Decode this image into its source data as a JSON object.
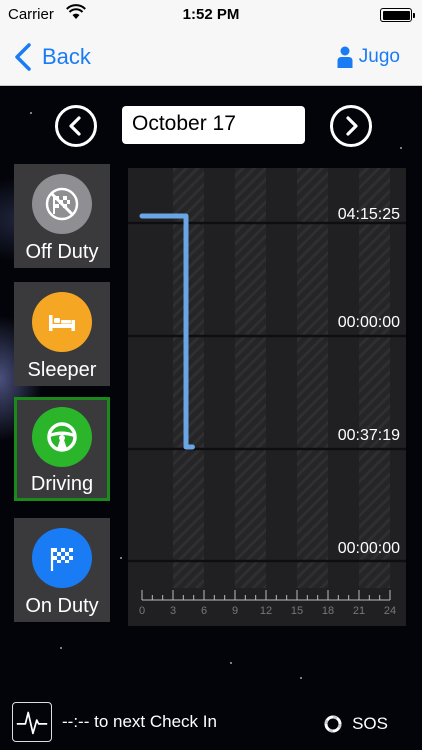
{
  "status_bar": {
    "carrier": "Carrier",
    "time": "1:52 PM"
  },
  "nav": {
    "back_label": "Back",
    "user_label": "Jugo",
    "accent": "#1a7cf5"
  },
  "date_selector": {
    "date": "October 17",
    "prev_icon": "chevron-left-circle-icon",
    "next_icon": "chevron-right-circle-icon"
  },
  "statuses": [
    {
      "key": "off-duty",
      "label": "Off Duty",
      "icon": "no-checkered-flag-icon",
      "color": "#8e8e93",
      "active": false
    },
    {
      "key": "sleeper",
      "label": "Sleeper",
      "icon": "bed-icon",
      "color": "#f5a623",
      "active": false
    },
    {
      "key": "driving",
      "label": "Driving",
      "icon": "steering-wheel-icon",
      "color": "#2bb52b",
      "active": true
    },
    {
      "key": "on-duty",
      "label": "On Duty",
      "icon": "checkered-flag-icon",
      "color": "#1a7cf5",
      "active": false
    }
  ],
  "chart_data": {
    "type": "line",
    "x_ticks": [
      "0",
      "3",
      "6",
      "9",
      "12",
      "15",
      "18",
      "21",
      "24"
    ],
    "xlim": [
      0,
      24
    ],
    "rows": [
      "Off Duty",
      "Sleeper",
      "Driving",
      "On Duty"
    ],
    "durations": [
      "04:15:25",
      "00:00:00",
      "00:37:19",
      "00:00:00"
    ],
    "line_color": "#6aa6e6",
    "series": [
      {
        "values": [
          [
            0,
            "Off Duty"
          ],
          [
            4.26,
            "Off Duty"
          ],
          [
            4.26,
            "Driving"
          ],
          [
            4.88,
            "Driving"
          ]
        ]
      }
    ]
  },
  "bottom": {
    "checkin_text": "--:-- to next Check In",
    "sos_label": "SOS"
  }
}
